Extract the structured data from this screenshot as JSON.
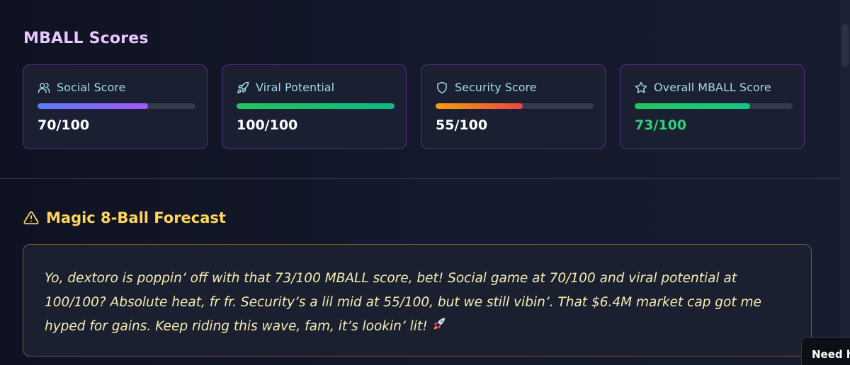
{
  "scores": {
    "title": "MBALL Scores",
    "cards": [
      {
        "icon": "users-icon",
        "label": "Social Score",
        "value_text": "70/100",
        "score": 70,
        "bar_colors": [
          "#5b7cf7",
          "#a259f7"
        ]
      },
      {
        "icon": "rocket-icon",
        "label": "Viral Potential",
        "value_text": "100/100",
        "score": 100,
        "bar_colors": [
          "#22c55e",
          "#10b981"
        ]
      },
      {
        "icon": "shield-icon",
        "label": "Security Score",
        "value_text": "55/100",
        "score": 55,
        "bar_colors": [
          "#f59e0b",
          "#ef4444"
        ]
      },
      {
        "icon": "star-icon",
        "label": "Overall MBALL Score",
        "value_text": "73/100",
        "score": 73,
        "bar_colors": [
          "#22c55e",
          "#16c784"
        ]
      }
    ]
  },
  "forecast": {
    "icon": "warning-triangle-icon",
    "title": "Magic 8-Ball Forecast",
    "text": "Yo, dextoro is poppin’ off with that 73/100 MBALL score, bet! Social game at 70/100 and viral potential at 100/100? Absolute heat, fr fr. Security’s a lil mid at 55/100, but we still vibin’. That $6.4M market cap got me hyped for gains. Keep riding this wave, fam, it’s lookin’ lit!",
    "trailing_icon": "rocket-emoji-icon"
  },
  "help_tab": {
    "label": "Need h"
  },
  "colors": {
    "accent_purple": "#5b2b8f",
    "title_pink": "#e8c8ff",
    "label_cyan": "#9ed8ea",
    "overall_green": "#33d17a",
    "forecast_yellow": "#ffd65a",
    "forecast_text": "#f6ecb0"
  }
}
